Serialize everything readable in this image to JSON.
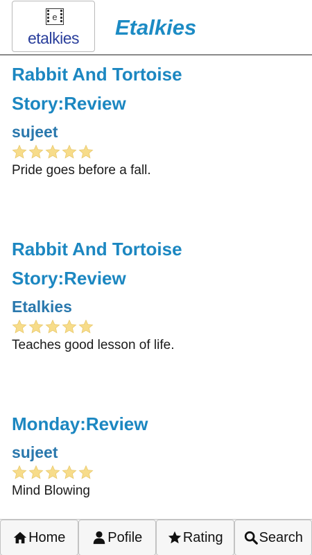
{
  "header": {
    "logo_text": "etalkies",
    "title": "Etalkies"
  },
  "reviews": [
    {
      "title_line1": "Rabbit And Tortoise",
      "title_line2": "Story:Review",
      "author": "sujeet",
      "rating": 5,
      "text": "Pride goes before a fall."
    },
    {
      "title_line1": "Rabbit And Tortoise",
      "title_line2": "Story:Review",
      "author": "Etalkies",
      "rating": 5,
      "text": "Teaches good lesson of life."
    },
    {
      "title_line1": "Monday:Review",
      "title_line2": "",
      "author": "sujeet",
      "rating": 5,
      "text": "Mind Blowing"
    }
  ],
  "tabs": [
    {
      "label": "Home",
      "icon": "home-icon"
    },
    {
      "label": "Pofile",
      "icon": "person-icon"
    },
    {
      "label": "Rating",
      "icon": "star-icon"
    },
    {
      "label": "Search",
      "icon": "search-icon"
    }
  ],
  "colors": {
    "title": "#1c87c1",
    "author": "#2a78ad",
    "star": "#f7dc8a"
  }
}
